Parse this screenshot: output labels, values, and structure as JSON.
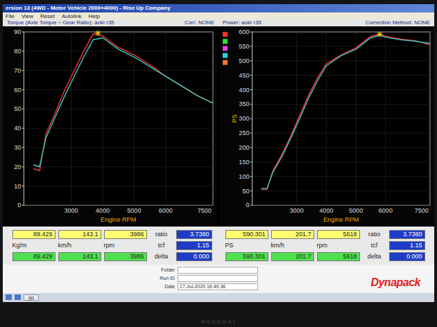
{
  "window": {
    "title": "ersion 13 (4WD - Motor Vehicle 2000+4000) - Rise Up Company"
  },
  "menu": [
    "File",
    "View",
    "Reset",
    "Autolink",
    "Help"
  ],
  "charts": [
    {
      "title": "Torque (Axle Torque ÷ Gear Ratio): aoki r35",
      "correction": "Corr: NONE",
      "y_label": "",
      "x_label": "Engine RPM",
      "x_min": 1500,
      "x_max": 7500,
      "y_max": 90,
      "y_step": 10,
      "y_ticks": [
        "0",
        "10",
        "20",
        "30",
        "40",
        "50",
        "60",
        "70",
        "80",
        "90"
      ],
      "x_ticks": [
        {
          "label": "3000",
          "rpm": 3000
        },
        {
          "label": "4000",
          "rpm": 4000
        },
        {
          "label": "5000",
          "rpm": 5000
        },
        {
          "label": "6000",
          "rpm": 6000
        },
        {
          "label": "7500",
          "rpm": 7500
        }
      ],
      "legend": [],
      "rpm": [
        1800,
        2000,
        2200,
        2500,
        2800,
        3100,
        3400,
        3700,
        4000,
        4500,
        5000,
        5500,
        6000,
        6500,
        7000,
        7500
      ],
      "series": [
        {
          "color": "#ff3030",
          "values": [
            19,
            18,
            37,
            48,
            60,
            70,
            80,
            89,
            88,
            82,
            78,
            73,
            67,
            62,
            57,
            53
          ]
        },
        {
          "color": "#3cc8c8",
          "values": [
            21,
            20,
            35,
            46,
            57,
            67,
            77,
            86,
            87,
            81,
            77,
            72,
            67,
            62,
            57,
            53
          ]
        }
      ],
      "peak": {
        "rpm": 3850,
        "value": 89.4
      },
      "readout": {
        "primary": [
          "89.429",
          "143.1",
          "3986"
        ],
        "units": [
          "Kg/m",
          "km/h",
          "rpm"
        ],
        "secondary": [
          "89.429",
          "143.1",
          "3986"
        ],
        "params": [
          {
            "label": "ratio",
            "value": "3.7380"
          },
          {
            "label": "tcf",
            "value": "1.15"
          },
          {
            "label": "delta",
            "value": "0.000"
          }
        ]
      }
    },
    {
      "title": "Power: aoki r35",
      "correction": "Correction Method: NONE",
      "y_label": "PS",
      "x_label": "Engine RPM",
      "x_min": 1500,
      "x_max": 7500,
      "y_max": 600,
      "y_step": 50,
      "y_ticks": [
        "0",
        "50",
        "100",
        "150",
        "200",
        "250",
        "300",
        "350",
        "400",
        "450",
        "500",
        "550",
        "600"
      ],
      "x_ticks": [
        {
          "label": "3000",
          "rpm": 3000
        },
        {
          "label": "4000",
          "rpm": 4000
        },
        {
          "label": "5000",
          "rpm": 5000
        },
        {
          "label": "6000",
          "rpm": 6000
        },
        {
          "label": "7500",
          "rpm": 7500
        }
      ],
      "legend": [
        {
          "color": "#ff3030"
        },
        {
          "color": "#30e030"
        },
        {
          "color": "#e040e0"
        },
        {
          "color": "#30d0e0"
        },
        {
          "color": "#ff7030"
        }
      ],
      "rpm": [
        1800,
        2000,
        2200,
        2500,
        2800,
        3100,
        3400,
        3700,
        4000,
        4500,
        5000,
        5500,
        5800,
        6000,
        6500,
        7000,
        7500
      ],
      "series": [
        {
          "color": "#ff3030",
          "values": [
            55,
            55,
            120,
            175,
            240,
            310,
            380,
            440,
            490,
            520,
            545,
            585,
            592,
            585,
            575,
            570,
            555
          ]
        },
        {
          "color": "#3cc8c8",
          "values": [
            58,
            58,
            115,
            168,
            232,
            300,
            370,
            430,
            483,
            518,
            540,
            580,
            588,
            582,
            573,
            568,
            560
          ]
        }
      ],
      "peak": {
        "rpm": 5800,
        "value": 592
      },
      "readout": {
        "primary": [
          "590.301",
          "201.7",
          "5618"
        ],
        "units": [
          "PS",
          "km/h",
          "rpm"
        ],
        "secondary": [
          "590.301",
          "201.7",
          "5618"
        ],
        "params": [
          {
            "label": "ratio",
            "value": "3.7380"
          },
          {
            "label": "tcf",
            "value": "1.15"
          },
          {
            "label": "delta",
            "value": "0.000"
          }
        ]
      }
    }
  ],
  "footer": {
    "fields": [
      {
        "label": "Folder",
        "value": ""
      },
      {
        "label": "Run ID",
        "value": ""
      },
      {
        "label": "Date",
        "value": "17-Jul-2020 16:49:36"
      }
    ],
    "logo": "Dynapack"
  },
  "taskbar": {
    "items": [
      "pp"
    ]
  },
  "brand": "HYUNDAI"
}
